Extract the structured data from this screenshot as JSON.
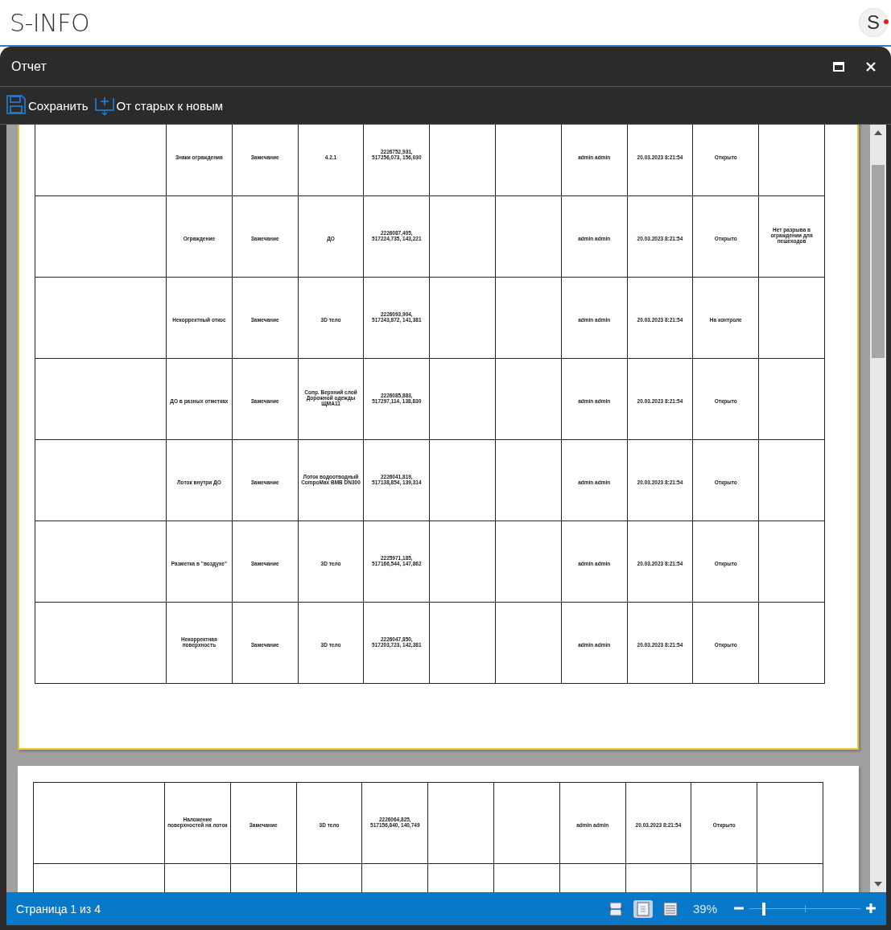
{
  "app": {
    "title": "S-INFO",
    "avatar": "S"
  },
  "window": {
    "title": "Отчет"
  },
  "toolbar": [
    {
      "kind": "save",
      "label": "Сохранить"
    },
    {
      "kind": "sort",
      "label": "От старых к новым"
    }
  ],
  "pages": [
    {
      "rows": [
        {
          "column_2": "Знаки ограждения",
          "column_3": "Замечание",
          "column_4": "4.2.1",
          "column_5": "2226752,931, 517256,073, 156,030",
          "column_8": "admin admin",
          "column_9": "20.03.2023 8:21:54",
          "column_10": "Открыто"
        },
        {
          "column_2": "Ограждение",
          "column_3": "Замечание",
          "column_4": "ДО",
          "column_5": "2226087,405, 517224,735, 143,221",
          "column_8": "admin admin",
          "column_9": "20.03.2023 8:21:54",
          "column_10": "Открыто",
          "column_11": "Нет разрыва в ограждении для пешеходов"
        },
        {
          "column_2": "Некорректный откос",
          "column_3": "Замечание",
          "column_4": "3D тело",
          "column_5": "2226093,904, 517243,872, 141,381",
          "column_8": "admin admin",
          "column_9": "20.03.2023 8:21:54",
          "column_10": "На контроле"
        },
        {
          "column_2": "ДО в разных отметках",
          "column_3": "Замечание",
          "column_4": "Сопр. Верхний слой Дорожной одежды ЩМА11",
          "column_5": "2226085,883, 517297,114, 138,830",
          "column_8": "admin admin",
          "column_9": "20.03.2023 8:21:54",
          "column_10": "Открыто"
        },
        {
          "column_2": "Лоток внутри ДО",
          "column_3": "Замечание",
          "column_4": "Лоток водоотводный CompoMax BMB DN300",
          "column_5": "2226041,819, 517138,854, 139,314",
          "column_8": "admin admin",
          "column_9": "20.03.2023 8:21:54",
          "column_10": "Открыто"
        },
        {
          "column_2": "Разметка в \"воздухе\"",
          "column_3": "Замечание",
          "column_4": "3D тело",
          "column_5": "2225971,185, 517166,544, 147,862",
          "column_8": "admin admin",
          "column_9": "20.03.2023 8:21:54",
          "column_10": "Открыто"
        },
        {
          "column_2": "Некорректная поверхность",
          "column_3": "Замечание",
          "column_4": "3D тело",
          "column_5": "2226047,850, 517203,723, 142,381",
          "column_8": "admin admin",
          "column_9": "20.03.2023 8:21:54",
          "column_10": "Открыто"
        }
      ]
    },
    {
      "rows": [
        {
          "column_2": "Наложение поверхностей на лоток",
          "column_3": "Замечание",
          "column_4": "3D тело",
          "column_5": "2226064,825, 517156,840, 140,749",
          "column_8": "admin admin",
          "column_9": "20.03.2023 8:21:54",
          "column_10": "Открыто"
        },
        {}
      ]
    }
  ],
  "status_bar": {
    "page": "Страница 1 из 4",
    "views": [
      {
        "kind": "fit-width",
        "selected": false
      },
      {
        "kind": "single-page",
        "selected": true
      },
      {
        "kind": "continuous",
        "selected": false
      }
    ],
    "zoom": "39%",
    "zoom_slider": {
      "level": 0.13
    }
  }
}
